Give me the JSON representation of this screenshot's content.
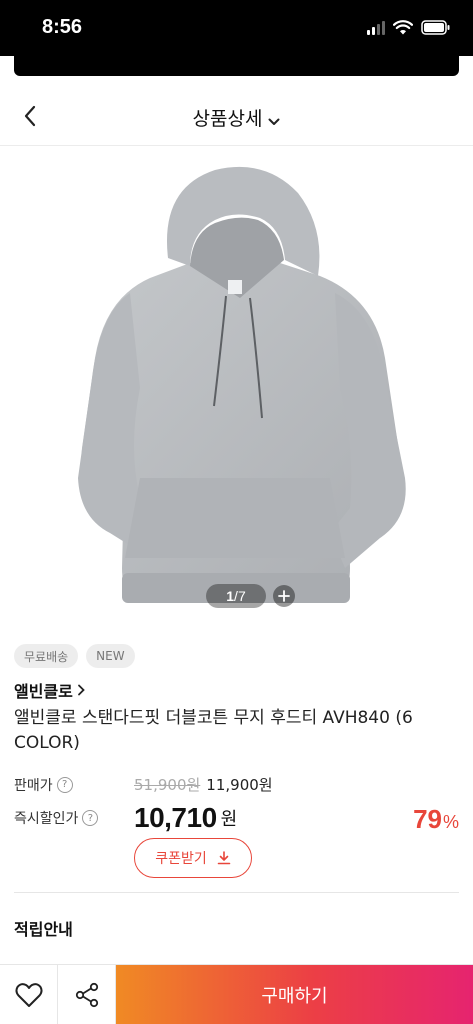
{
  "status_bar": {
    "time": "8:56"
  },
  "header": {
    "title": "상품상세"
  },
  "gallery": {
    "current": "1",
    "total": "7",
    "separator": "/"
  },
  "badges": [
    "무료배송",
    "NEW"
  ],
  "product": {
    "brand": "앨빈클로",
    "name": "앨빈클로 스탠다드핏 더블코튼 무지 후드티 AVH840 (6 COLOR)"
  },
  "pricing": {
    "sale_label": "판매가",
    "original_price": "51,900원",
    "sale_price": "11,900원",
    "instant_label": "즉시할인가",
    "final_price": "10,710",
    "final_unit": "원",
    "discount_value": "79",
    "discount_unit": "%"
  },
  "coupon": {
    "label": "쿠폰받기"
  },
  "points": {
    "title": "적립안내"
  },
  "bottom_bar": {
    "buy_label": "구매하기"
  },
  "colors": {
    "accent": "#e8463a",
    "buy_gradient_start": "#f08a24",
    "buy_gradient_end": "#e6246f",
    "hoodie": "#b9bcc0"
  },
  "icons": [
    "chevron-left-icon",
    "chevron-down-icon",
    "plus-icon",
    "question-icon",
    "chevron-right-icon",
    "download-icon",
    "heart-icon",
    "share-icon"
  ]
}
